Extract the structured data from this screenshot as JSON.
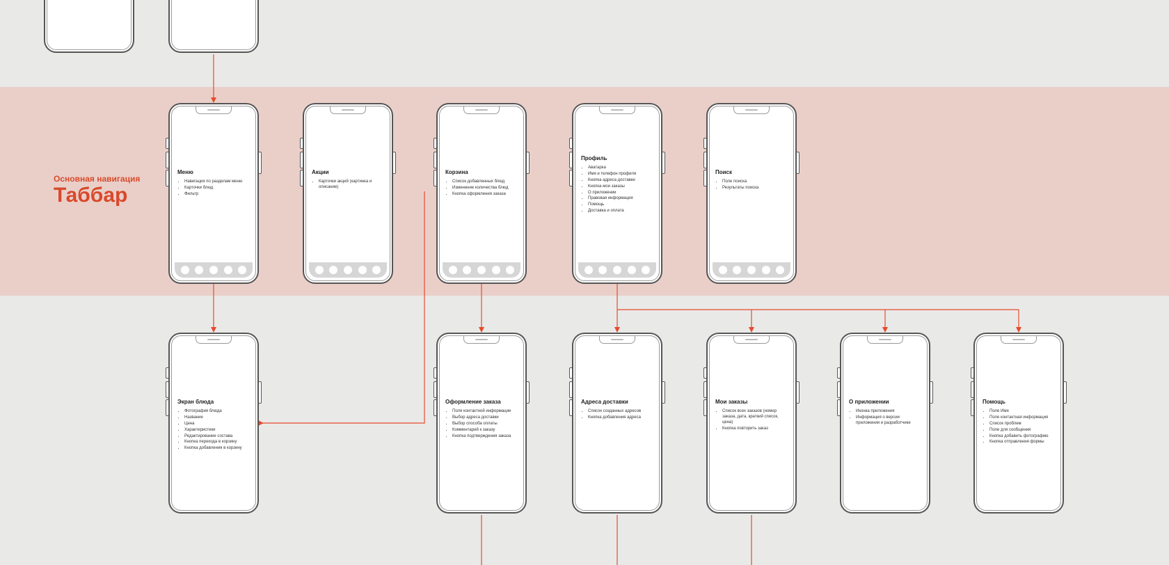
{
  "section": {
    "subtitle": "Основная навигация",
    "title": "Таббар"
  },
  "phones": {
    "top1": {
      "title": "",
      "items": []
    },
    "top2": {
      "title": "",
      "items": []
    },
    "menu": {
      "title": "Меню",
      "items": [
        "Навигация по разделам меню",
        "Карточки блюд",
        "Фильтр"
      ]
    },
    "promo": {
      "title": "Акции",
      "items": [
        "Карточки акций (картинка и описание)"
      ]
    },
    "cart": {
      "title": "Корзина",
      "items": [
        "Список добавленных блюд",
        "Изменение количества блюд",
        "Кнопка оформления заказа"
      ]
    },
    "profile": {
      "title": "Профиль",
      "items": [
        "Аватарка",
        "Имя и телефон профиля",
        "Кнопка адреса доставки",
        "Кнопка мои заказы",
        "О приложении",
        "Правовая информация",
        "Помощь",
        "Доставка и оплата"
      ]
    },
    "search": {
      "title": "Поиск",
      "items": [
        "Поле поиска",
        "Результаты поиска"
      ]
    },
    "dish": {
      "title": "Экран блюда",
      "items": [
        "Фотография блюда",
        "Название",
        "Цена",
        "Характеристики",
        "Редактирование состава",
        "Кнопка перехода в корзину",
        "Кнопка добавления в корзину"
      ]
    },
    "checkout": {
      "title": "Оформление заказа",
      "items": [
        "Поля контактной информации",
        "Выбор адреса доставки",
        "Выбор способа оплаты",
        "Комментарий к заказу",
        "Кнопка подтверждения заказа"
      ]
    },
    "addresses": {
      "title": "Адреса доставки",
      "items": [
        "Список созданных адресов",
        "Кнопка добавления адреса"
      ]
    },
    "orders": {
      "title": "Мои заказы",
      "items": [
        "Список всех заказов (номер заказа, дата, краткий список, цена)",
        "Кнопка повторить заказ"
      ]
    },
    "about": {
      "title": "О приложении",
      "items": [
        "Иконка приложения",
        "Информация о версии приложения и разработчике"
      ]
    },
    "help": {
      "title": "Помощь",
      "items": [
        "Поле Имя",
        "Поле контактная информация",
        "Список проблем",
        "Поле для сообщения",
        "Кнопка добавить фотографию",
        "Кнопка отправления формы"
      ]
    }
  }
}
